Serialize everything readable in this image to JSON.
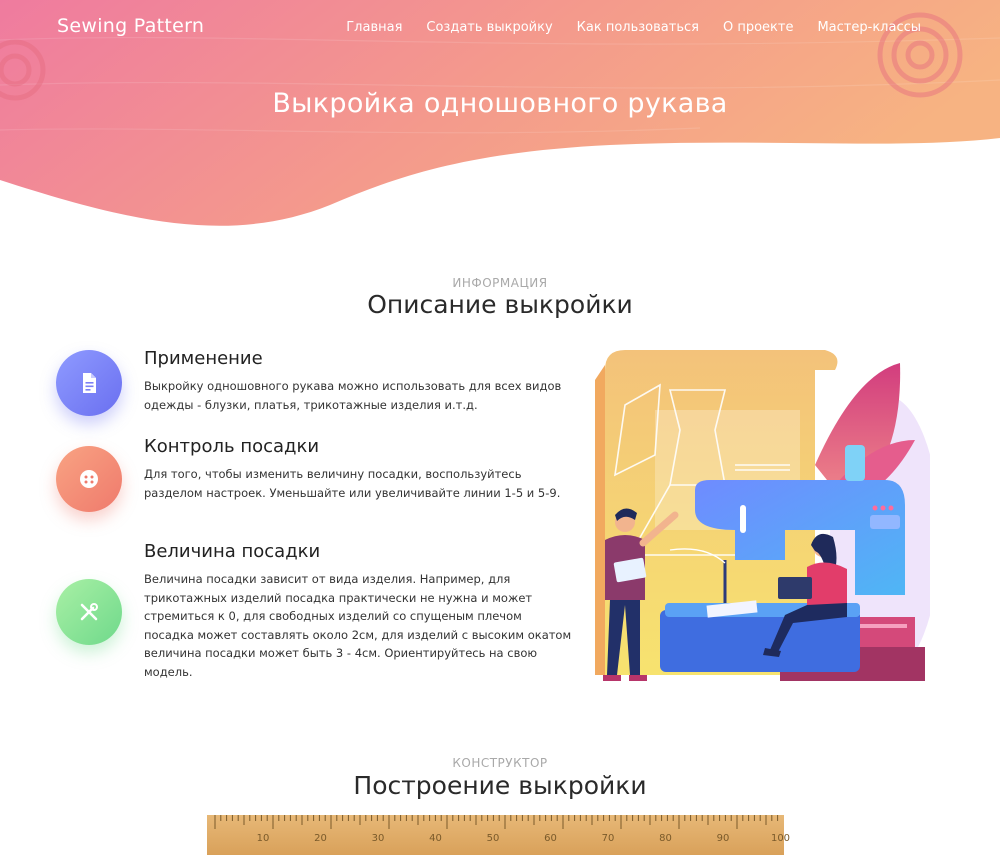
{
  "site": {
    "logo": "Sewing Pattern",
    "nav": [
      "Главная",
      "Создать выкройку",
      "Как пользоваться",
      "О проекте",
      "Мастер-классы"
    ]
  },
  "hero": {
    "title": "Выкройка одношовного рукава"
  },
  "info": {
    "overline": "ИНФОРМАЦИЯ",
    "title": "Описание выкройки",
    "features": [
      {
        "icon": "document-icon",
        "title": "Применение",
        "text": "Выкройку одношовного рукава можно использовать для всех видов одежды - блузки, платья, трикотажные изделия и.т.д."
      },
      {
        "icon": "button-icon",
        "title": "Контроль посадки",
        "text": "Для того, чтобы изменить величину посадки, воспользуйтесь разделом настроек. Уменьшайте или увеличивайте линии 1-5 и 5-9."
      },
      {
        "icon": "tools-icon",
        "title": "Величина посадки",
        "text": "Величина посадки зависит от вида изделия. Например, для трикотажных изделий посадка практически не нужна и может стремиться к 0, для свободных изделий со спущеным плечом посадка может составлять около 2см, для изделий с высоким окатом величина посадки может быть 3 - 4см. Ориентируйтесь на свою модель."
      }
    ]
  },
  "builder": {
    "overline": "КОНСТРУКТОР",
    "title": "Построение выкройки",
    "ruler_labels": [
      "10",
      "20",
      "30",
      "40",
      "50",
      "60",
      "70",
      "80",
      "90",
      "100"
    ]
  },
  "colors": {
    "hero_gradient_start": "#f07ea0",
    "hero_gradient_end": "#f6b183",
    "accent_purple": "#7b80f5",
    "accent_orange": "#f28e74",
    "accent_green": "#8ee49a"
  }
}
